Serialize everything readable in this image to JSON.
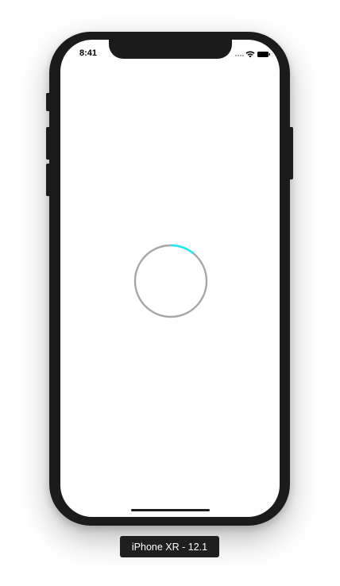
{
  "status_bar": {
    "time": "8:41",
    "icons": [
      "signal-dots-icon",
      "wifi-icon",
      "battery-icon"
    ]
  },
  "loader": {
    "track_color": "#a6a6a6",
    "progress_color": "#1de9f3",
    "progress": 0.11
  },
  "device_label": "iPhone XR - 12.1",
  "colors": {
    "device_frame": "#1b1b1b",
    "screen_background": "#ffffff",
    "label_background": "#1f1f1f"
  }
}
